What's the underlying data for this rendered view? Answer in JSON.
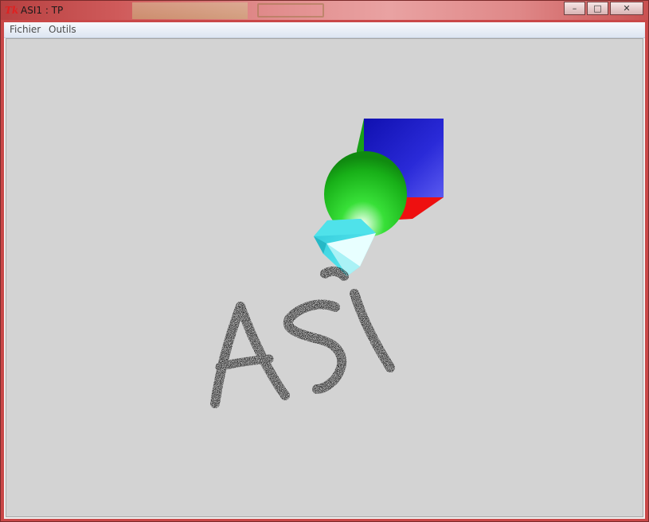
{
  "window": {
    "title": "ASI1 : TP",
    "app_icon": "tk-feather-icon",
    "controls": {
      "minimize_glyph": "–",
      "maximize_glyph": "□",
      "close_glyph": "✕"
    }
  },
  "menu": {
    "items": [
      {
        "label": "Fichier"
      },
      {
        "label": "Outils"
      }
    ]
  },
  "scene": {
    "background": "#d3d3d3",
    "objects": [
      {
        "name": "cube",
        "colors": [
          "#1c1cc8",
          "#ee1010",
          "#18a018"
        ]
      },
      {
        "name": "sphere",
        "color": "#22cc22"
      },
      {
        "name": "cone",
        "color": "#30e0e8"
      }
    ],
    "handwritten_text": "ASI"
  }
}
